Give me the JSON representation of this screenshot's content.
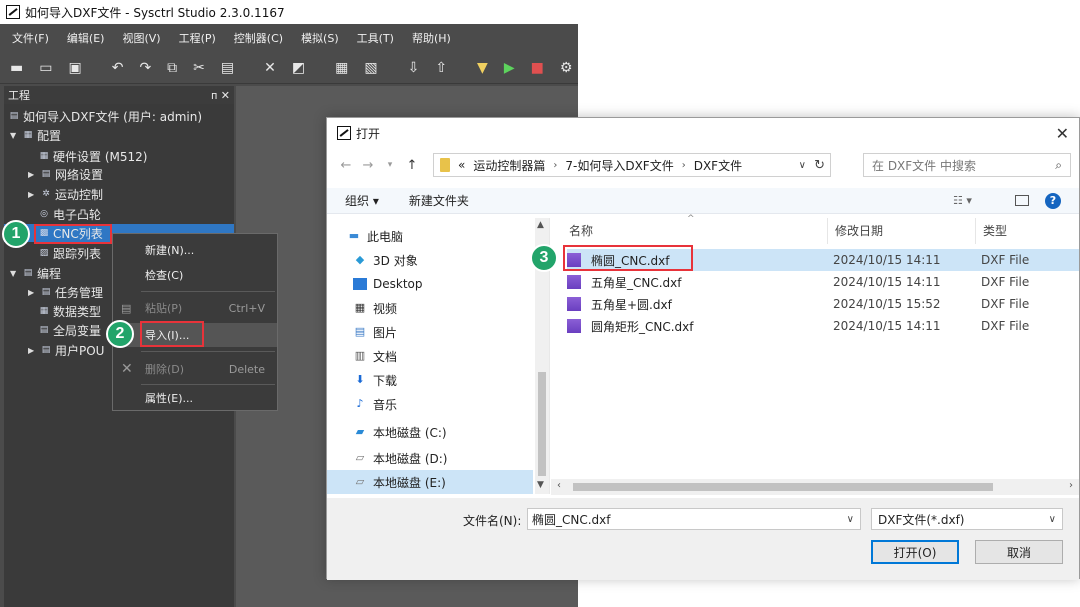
{
  "ide": {
    "title": "如何导入DXF文件 - Sysctrl Studio 2.3.0.1167",
    "menu": [
      "文件(F)",
      "编辑(E)",
      "视图(V)",
      "工程(P)",
      "控制器(C)",
      "模拟(S)",
      "工具(T)",
      "帮助(H)"
    ],
    "panel_title": "工程",
    "panel_pin": "ᴨ ✕",
    "tree": {
      "root": "如何导入DXF文件 (用户: admin)",
      "config": "配置",
      "hardware": "硬件设置 (M512)",
      "network": "网络设置",
      "motion": "运动控制",
      "cam": "电子凸轮",
      "cnc": "CNC列表",
      "trace": "跟踪列表",
      "program": "编程",
      "task": "任务管理",
      "datatype": "数据类型",
      "global": "全局变量",
      "userpou": "用户POU"
    }
  },
  "context_menu": {
    "new": "新建(N)...",
    "check": "检查(C)",
    "paste": "粘贴(P)",
    "paste_shortcut": "Ctrl+V",
    "import": "导入(I)...",
    "delete": "删除(D)",
    "delete_shortcut": "Delete",
    "properties": "属性(E)..."
  },
  "badges": {
    "one": "1",
    "two": "2",
    "three": "3"
  },
  "dialog": {
    "title": "打开",
    "breadcrumb": [
      "«",
      "运动控制器篇",
      "7-如何导入DXF文件",
      "DXF文件"
    ],
    "search_placeholder": "在 DXF文件 中搜索",
    "organize": "组织 ▾",
    "new_folder": "新建文件夹",
    "nav": [
      "此电脑",
      "3D 对象",
      "Desktop",
      "视频",
      "图片",
      "文档",
      "下载",
      "音乐",
      "本地磁盘 (C:)",
      "本地磁盘 (D:)",
      "本地磁盘 (E:)"
    ],
    "columns": {
      "name": "名称",
      "date": "修改日期",
      "type": "类型"
    },
    "files": [
      {
        "name": "椭圆_CNC.dxf",
        "date": "2024/10/15 14:11",
        "type": "DXF File"
      },
      {
        "name": "五角星_CNC.dxf",
        "date": "2024/10/15 14:11",
        "type": "DXF File"
      },
      {
        "name": "五角星+圆.dxf",
        "date": "2024/10/15 15:52",
        "type": "DXF File"
      },
      {
        "name": "圆角矩形_CNC.dxf",
        "date": "2024/10/15 14:11",
        "type": "DXF File"
      }
    ],
    "filename_label": "文件名(N):",
    "filename_value": "椭圆_CNC.dxf",
    "filetype": "DXF文件(*.dxf)",
    "open_button": "打开(O)",
    "cancel_button": "取消"
  },
  "colors": {
    "highlight_box": "#e8333a",
    "badge": "#22a46a",
    "selection": "#cce4f7"
  }
}
